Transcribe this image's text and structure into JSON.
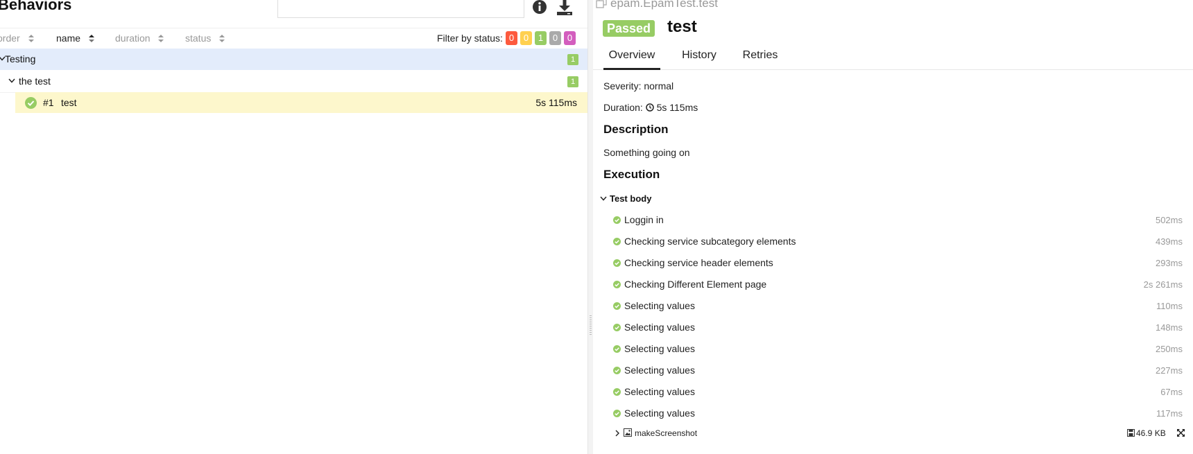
{
  "left": {
    "title": "Behaviors",
    "search": {
      "value": "",
      "placeholder": ""
    },
    "sort_columns": [
      {
        "label": "order",
        "active": false
      },
      {
        "label": "name",
        "active": true
      },
      {
        "label": "duration",
        "active": false
      },
      {
        "label": "status",
        "active": false
      }
    ],
    "filter": {
      "label": "Filter by status:",
      "badges": [
        {
          "status": "failed",
          "count": "0",
          "color": "#fd5a3e"
        },
        {
          "status": "broken",
          "count": "0",
          "color": "#ffd050"
        },
        {
          "status": "passed",
          "count": "1",
          "color": "#97cc64"
        },
        {
          "status": "skipped",
          "count": "0",
          "color": "#aaaaaa"
        },
        {
          "status": "unknown",
          "count": "0",
          "color": "#d35ebe"
        }
      ]
    },
    "tree": {
      "feature": {
        "label": "Testing",
        "count": "1"
      },
      "story": {
        "label": "the test",
        "count": "1"
      },
      "test": {
        "order": "#1",
        "name": "test",
        "duration": "5s 115ms"
      }
    }
  },
  "right": {
    "full_name": "epam.EpamTest.test",
    "status": "Passed",
    "title": "test",
    "tabs": [
      "Overview",
      "History",
      "Retries"
    ],
    "severity": "Severity: normal",
    "duration_label": "Duration:",
    "duration_value": "5s 115ms",
    "description_heading": "Description",
    "description_text": "Something going on",
    "execution_heading": "Execution",
    "test_body_label": "Test body",
    "steps": [
      {
        "name": "Loggin in",
        "duration": "502ms"
      },
      {
        "name": "Checking service subcategory elements",
        "duration": "439ms"
      },
      {
        "name": "Checking service header elements",
        "duration": "293ms"
      },
      {
        "name": "Checking Different Element page",
        "duration": "2s 261ms"
      },
      {
        "name": "Selecting values",
        "duration": "110ms"
      },
      {
        "name": "Selecting values",
        "duration": "148ms"
      },
      {
        "name": "Selecting values",
        "duration": "250ms"
      },
      {
        "name": "Selecting values",
        "duration": "227ms"
      },
      {
        "name": "Selecting values",
        "duration": "67ms"
      },
      {
        "name": "Selecting values",
        "duration": "117ms"
      }
    ],
    "attachment": {
      "name": "makeScreenshot",
      "size": "46.9 KB"
    }
  },
  "colors": {
    "passed": "#97cc64",
    "selected_group_bg": "#e3ecfb",
    "selected_row_bg": "#fdf7cc",
    "muted_text": "#999999"
  },
  "icons": [
    "info-icon",
    "download-icon",
    "sort-icon",
    "chevron-down-icon",
    "passed-check-icon",
    "copy-icon",
    "clock-icon",
    "chevron-right-icon",
    "image-icon",
    "save-icon",
    "expand-icon"
  ]
}
